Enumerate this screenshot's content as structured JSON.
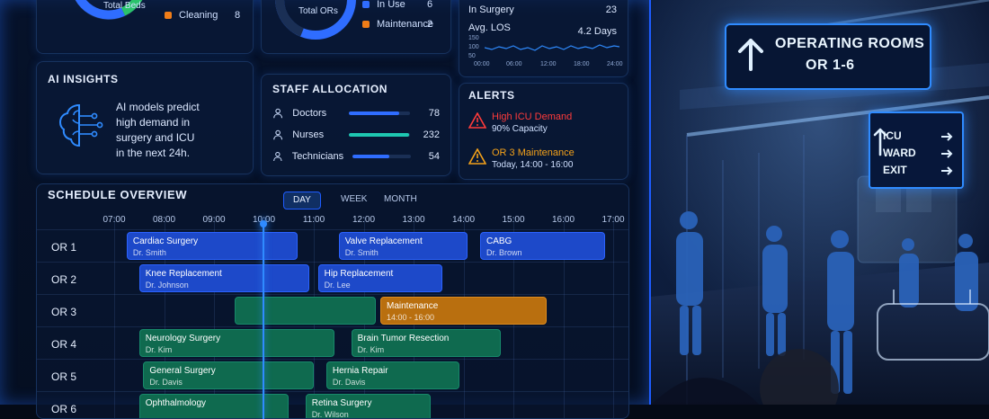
{
  "dashboard": {
    "beds_card": {
      "donut_label": "Total Beds",
      "legend": [
        {
          "label": "Cleaning",
          "value": "8",
          "color": "#f07d18"
        }
      ]
    },
    "or_card": {
      "donut_label": "Total ORs",
      "legend": [
        {
          "label": "In Use",
          "value": "6",
          "color": "#2f6dff"
        },
        {
          "label": "Maintenance",
          "value": "2",
          "color": "#f07d18"
        }
      ]
    },
    "flow_card": {
      "in_surgery_label": "In Surgery",
      "in_surgery_value": "23",
      "avg_los_label": "Avg. LOS",
      "avg_los_value": "4.2 Days",
      "y_ticks": [
        "150",
        "100",
        "50"
      ],
      "x_ticks": [
        "00:00",
        "06:00",
        "12:00",
        "18:00",
        "24:00"
      ]
    },
    "ai_insights": {
      "title": "AI INSIGHTS",
      "text_lines": [
        "AI models predict",
        "high demand in",
        "surgery and ICU",
        "in the next 24h."
      ]
    },
    "staff_allocation": {
      "title": "STAFF ALLOCATION",
      "rows": [
        {
          "label": "Doctors",
          "value": "78",
          "fill_pct": 82,
          "color": "#2f6dff"
        },
        {
          "label": "Nurses",
          "value": "232",
          "fill_pct": 98,
          "color": "#1ec7b1"
        },
        {
          "label": "Technicians",
          "value": "54",
          "fill_pct": 63,
          "color": "#2f6dff"
        }
      ]
    },
    "alerts": {
      "title": "ALERTS",
      "items": [
        {
          "title": "High ICU Demand",
          "detail": "90% Capacity",
          "color": "#ff3b3b"
        },
        {
          "title": "OR 3 Maintenance",
          "detail": "Today, 14:00 - 16:00",
          "color": "#f3a11a"
        }
      ]
    },
    "schedule": {
      "title": "SCHEDULE OVERVIEW",
      "tabs": [
        "DAY",
        "WEEK",
        "MONTH"
      ],
      "active_tab": "DAY",
      "times": [
        "07:00",
        "08:00",
        "09:00",
        "10:00",
        "11:00",
        "12:00",
        "13:00",
        "14:00",
        "15:00",
        "16:00",
        "17:00"
      ],
      "current_time": "10:00",
      "rooms": [
        "OR 1",
        "OR 2",
        "OR 3",
        "OR 4",
        "OR 5",
        "OR 6"
      ],
      "events": [
        {
          "room": "OR 1",
          "start": "07:15",
          "end": "10:40",
          "title": "Cardiac Surgery",
          "subtitle": "Dr. Smith",
          "color": "blue"
        },
        {
          "room": "OR 1",
          "start": "11:30",
          "end": "14:05",
          "title": "Valve Replacement",
          "subtitle": "Dr. Smith",
          "color": "blue"
        },
        {
          "room": "OR 1",
          "start": "14:20",
          "end": "16:50",
          "title": "CABG",
          "subtitle": "Dr. Brown",
          "color": "blue"
        },
        {
          "room": "OR 2",
          "start": "07:30",
          "end": "10:55",
          "title": "Knee Replacement",
          "subtitle": "Dr. Johnson",
          "color": "blue"
        },
        {
          "room": "OR 2",
          "start": "11:05",
          "end": "13:35",
          "title": "Hip Replacement",
          "subtitle": "Dr. Lee",
          "color": "blue"
        },
        {
          "room": "OR 3",
          "start": "09:25",
          "end": "12:15",
          "title": "",
          "subtitle": "",
          "color": "green"
        },
        {
          "room": "OR 3",
          "start": "12:20",
          "end": "15:40",
          "title": "Maintenance",
          "subtitle": "14:00 - 16:00",
          "color": "orange"
        },
        {
          "room": "OR 4",
          "start": "07:30",
          "end": "11:25",
          "title": "Neurology Surgery",
          "subtitle": "Dr. Kim",
          "color": "green"
        },
        {
          "room": "OR 4",
          "start": "11:45",
          "end": "14:45",
          "title": "Brain Tumor Resection",
          "subtitle": "Dr. Kim",
          "color": "green"
        },
        {
          "room": "OR 5",
          "start": "07:35",
          "end": "11:00",
          "title": "General Surgery",
          "subtitle": "Dr. Davis",
          "color": "green"
        },
        {
          "room": "OR 5",
          "start": "11:15",
          "end": "13:55",
          "title": "Hernia Repair",
          "subtitle": "Dr. Davis",
          "color": "green"
        },
        {
          "room": "OR 6",
          "start": "07:30",
          "end": "10:30",
          "title": "Ophthalmology",
          "subtitle": "",
          "color": "green"
        },
        {
          "room": "OR 6",
          "start": "10:50",
          "end": "13:20",
          "title": "Retina Surgery",
          "subtitle": "Dr. Wilson",
          "color": "green"
        }
      ]
    }
  },
  "hallway": {
    "main_sign": {
      "line1": "OPERATING ROOMS",
      "line2": "OR 1-6"
    },
    "side_sign": {
      "lines": [
        "ICU",
        "WARD",
        "EXIT"
      ]
    }
  }
}
